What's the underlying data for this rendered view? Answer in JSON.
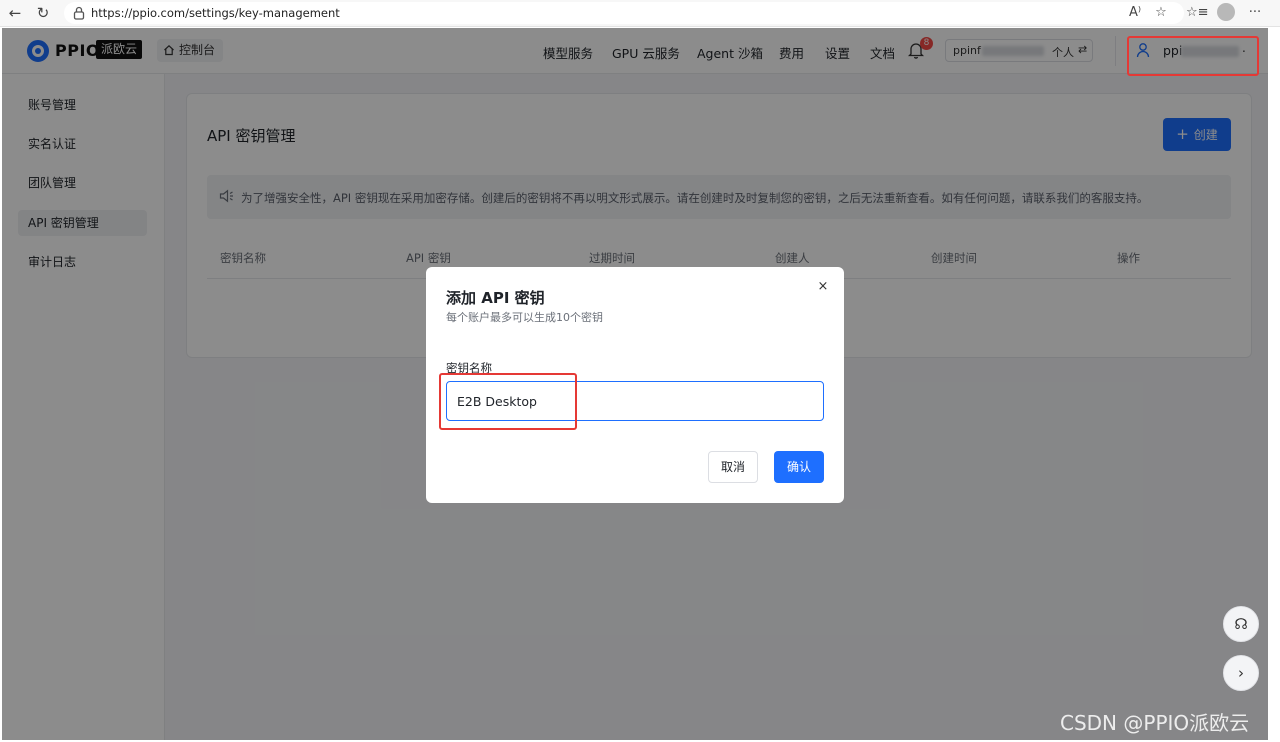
{
  "browser": {
    "url": "https://ppio.com/settings/key-management",
    "icons": [
      "back-icon",
      "reload-icon",
      "lock-icon",
      "read-aloud-icon",
      "favorite-star-icon",
      "favorites-icon",
      "profile-icon",
      "more-icon"
    ],
    "back_glyph": "←",
    "reload_glyph": "↻",
    "read_aloud_glyph": "A⁾",
    "star_glyph": "☆",
    "favorites_glyph": "☆≡",
    "more_glyph": "···"
  },
  "header": {
    "logo_text": "PPIO",
    "logo_badge": "派欧云",
    "console_label": "控制台",
    "nav": [
      "模型服务",
      "GPU 云服务",
      "Agent 沙箱",
      "费用",
      "设置",
      "文档"
    ],
    "notification_count": "8",
    "account_name": "ppinf",
    "account_type": "个人",
    "swap_glyph": "⇄",
    "user_name": "ppi",
    "user_suffix": "."
  },
  "sidebar": {
    "items": [
      "账号管理",
      "实名认证",
      "团队管理",
      "API 密钥管理",
      "审计日志"
    ],
    "active_index": 3
  },
  "page": {
    "title": "API 密钥管理",
    "create_label": "创建",
    "create_glyph": "+",
    "notice": "为了增强安全性，API 密钥现在采用加密存储。创建后的密钥将不再以明文形式展示。请在创建时及时复制您的密钥，之后无法重新查看。如有任何问题，请联系我们的客服支持。",
    "columns": [
      "密钥名称",
      "API 密钥",
      "过期时间",
      "创建人",
      "创建时间",
      "操作"
    ]
  },
  "modal": {
    "title": "添加 API 密钥",
    "subtitle": "每个账户最多可以生成10个密钥",
    "close_glyph": "×",
    "field_label": "密钥名称",
    "field_value": "E2B Desktop",
    "cancel_label": "取消",
    "confirm_label": "确认"
  },
  "floating": {
    "support_glyph": "☊",
    "next_glyph": "›"
  },
  "watermark": "CSDN @PPIO派欧云",
  "colors": {
    "accent": "#1e6fff",
    "badge": "#f54a45",
    "annotation": "#e53935"
  }
}
